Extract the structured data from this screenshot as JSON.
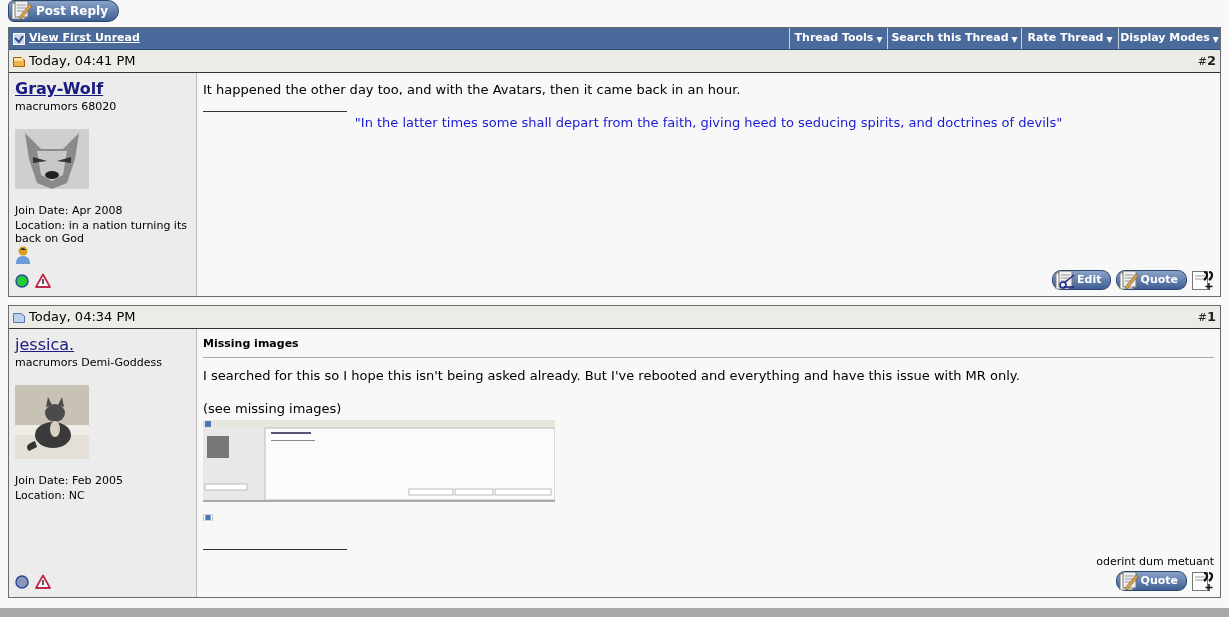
{
  "post_reply_button": "Post Reply",
  "navbar": {
    "first_unread": "View First Unread",
    "menus": [
      "Thread Tools",
      "Search this Thread",
      "Rate Thread",
      "Display Modes"
    ],
    "arrow": "▾"
  },
  "posts": [
    {
      "date": "Today, 04:41 PM",
      "new": true,
      "number_prefix": "#",
      "number": "2",
      "username": "Gray-Wolf",
      "bold_name": true,
      "rank": "macrumors 68020",
      "avatar": {
        "kind": "wolf"
      },
      "join_date": "Join Date: Apr 2008",
      "location": "Location: in a nation turning its back on God",
      "has_user_icon": true,
      "online": true,
      "message": [
        "It happened the other day too, and with the Avatars, then it came back in an hour."
      ],
      "signature": {
        "kind": "quote",
        "text": "\"In the latter times some shall depart from the faith, giving heed to seducing spirits, and doctrines of devils\""
      },
      "buttons": [
        "Edit",
        "Quote"
      ]
    },
    {
      "date": "Today, 04:34 PM",
      "new": false,
      "number_prefix": "#",
      "number": "1",
      "username": "jessica.",
      "bold_name": false,
      "rank": "macrumors Demi-Goddess",
      "avatar": {
        "kind": "cat"
      },
      "join_date": "Join Date: Feb 2005",
      "location": "Location: NC",
      "has_user_icon": false,
      "online": false,
      "title": "Missing images",
      "message": [
        "I searched for this so I hope this isn't being asked already. But I've rebooted and everything and have this issue with MR only.",
        "(see missing images)"
      ],
      "attachment": {
        "kind": "picture"
      },
      "signature": {
        "kind": "motto",
        "text": "oderint dum metuant"
      },
      "buttons": [
        "Quote"
      ]
    }
  ]
}
